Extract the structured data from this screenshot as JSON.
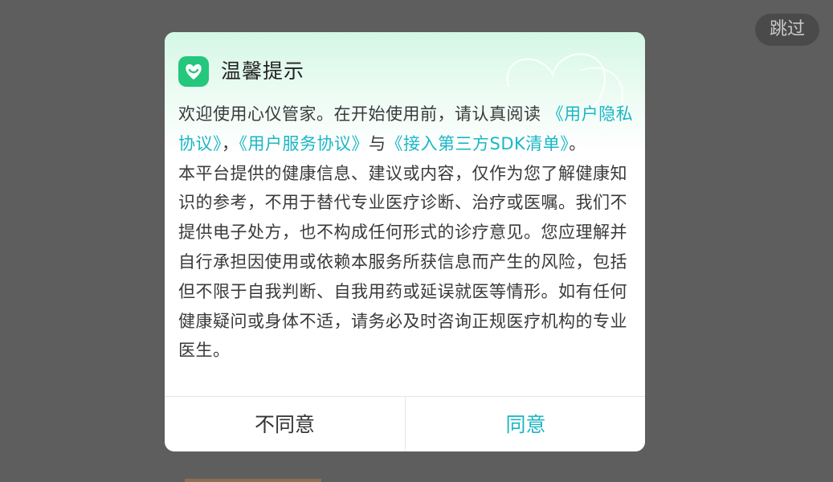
{
  "overlay": {
    "skip_label": "跳过"
  },
  "dialog": {
    "title": "温馨提示",
    "intro": {
      "prefix": "欢迎使用心仪管家。在开始使用前，请认真阅读 ",
      "link_privacy": "《用户隐私协议》",
      "sep1": "，",
      "link_service": "《用户服务协议》",
      "sep2": "与",
      "link_sdk": "《接入第三方SDK清单》",
      "suffix": "。"
    },
    "disclaimer": "本平台提供的健康信息、建议或内容，仅作为您了解健康知识的参考，不用于替代专业医疗诊断、治疗或医嘱。我们不提供电子处方，也不构成任何形式的诊疗意见。您应理解并自行承担因使用或依赖本服务所获信息而产生的风险，包括但不限于自我判断、自我用药或延误就医等情形。如有任何健康疑问或身体不适，请务必及时咨询正规医疗机构的专业医生。",
    "buttons": {
      "disagree": "不同意",
      "agree": "同意"
    }
  },
  "colors": {
    "accent": "#1bb6c6",
    "logo": "#24c77c",
    "overlay": "#5e5e5e"
  },
  "icons": {
    "logo": "heart-logo-icon",
    "decoration": "decorative-heart-outline-icon"
  }
}
